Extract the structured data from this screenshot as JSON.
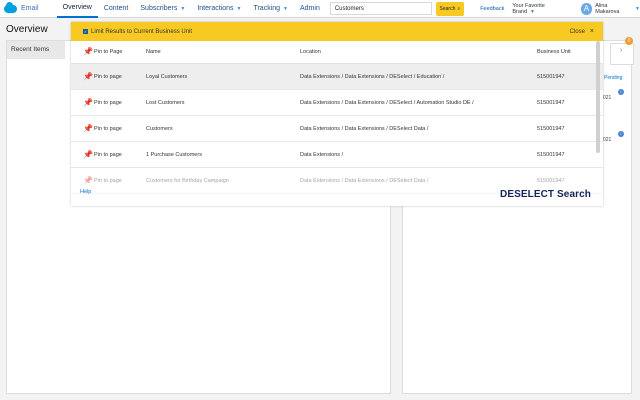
{
  "app": {
    "name": "Email"
  },
  "nav": {
    "tabs": [
      {
        "label": "Overview"
      },
      {
        "label": "Content"
      },
      {
        "label": "Subscribers"
      },
      {
        "label": "Interactions"
      },
      {
        "label": "Tracking"
      },
      {
        "label": "Admin"
      }
    ]
  },
  "search": {
    "value": "Customers",
    "button_label": "Search"
  },
  "header": {
    "feedback_label": "Feedback",
    "brand_label": "Your Favorite Brand",
    "user_name": "Alina Makarova",
    "avatar_initial": "A"
  },
  "page": {
    "title": "Overview",
    "recent_items": "Recent Items"
  },
  "dialog": {
    "limit_label": "Limit Results to Current Business Unit",
    "close_label": "Close",
    "columns": [
      "Pin to Page",
      "Name",
      "Location",
      "Business Unit"
    ],
    "rows": [
      {
        "pin_label": "Pin to page",
        "name": "Loyal Customers",
        "location": "Data Extensions / Data Extensions / DESelect / Education /",
        "business_unit": "515001947"
      },
      {
        "pin_label": "Pin to page",
        "name": "Lost Customers",
        "location": "Data Extensions / Data Extensions / DESelect / Automation Studio DE /",
        "business_unit": "515001947"
      },
      {
        "pin_label": "Pin to page",
        "name": "Customers",
        "location": "Data Extensions / Data Extensions / DESelect Data /",
        "business_unit": "515001947"
      },
      {
        "pin_label": "Pin to page",
        "name": "1 Purchase Customers",
        "location": "Data Extensions /",
        "business_unit": "515001947"
      },
      {
        "pin_label": "Pin to page",
        "name": "Customers for Birthday Campaign",
        "location": "Data Extensions / Data Extensions / DESelect Data /",
        "business_unit": "515001947"
      }
    ],
    "help_label": "Help",
    "brand_logo": "DESELECT",
    "brand_search": "Search"
  },
  "right_panel": {
    "badge_count": "0",
    "pending_label": "Pending",
    "text_1": "021",
    "text_2": "021"
  },
  "colors": {
    "accent": "#f7c922",
    "link": "#0070d2",
    "brand_navy": "#15245a"
  }
}
